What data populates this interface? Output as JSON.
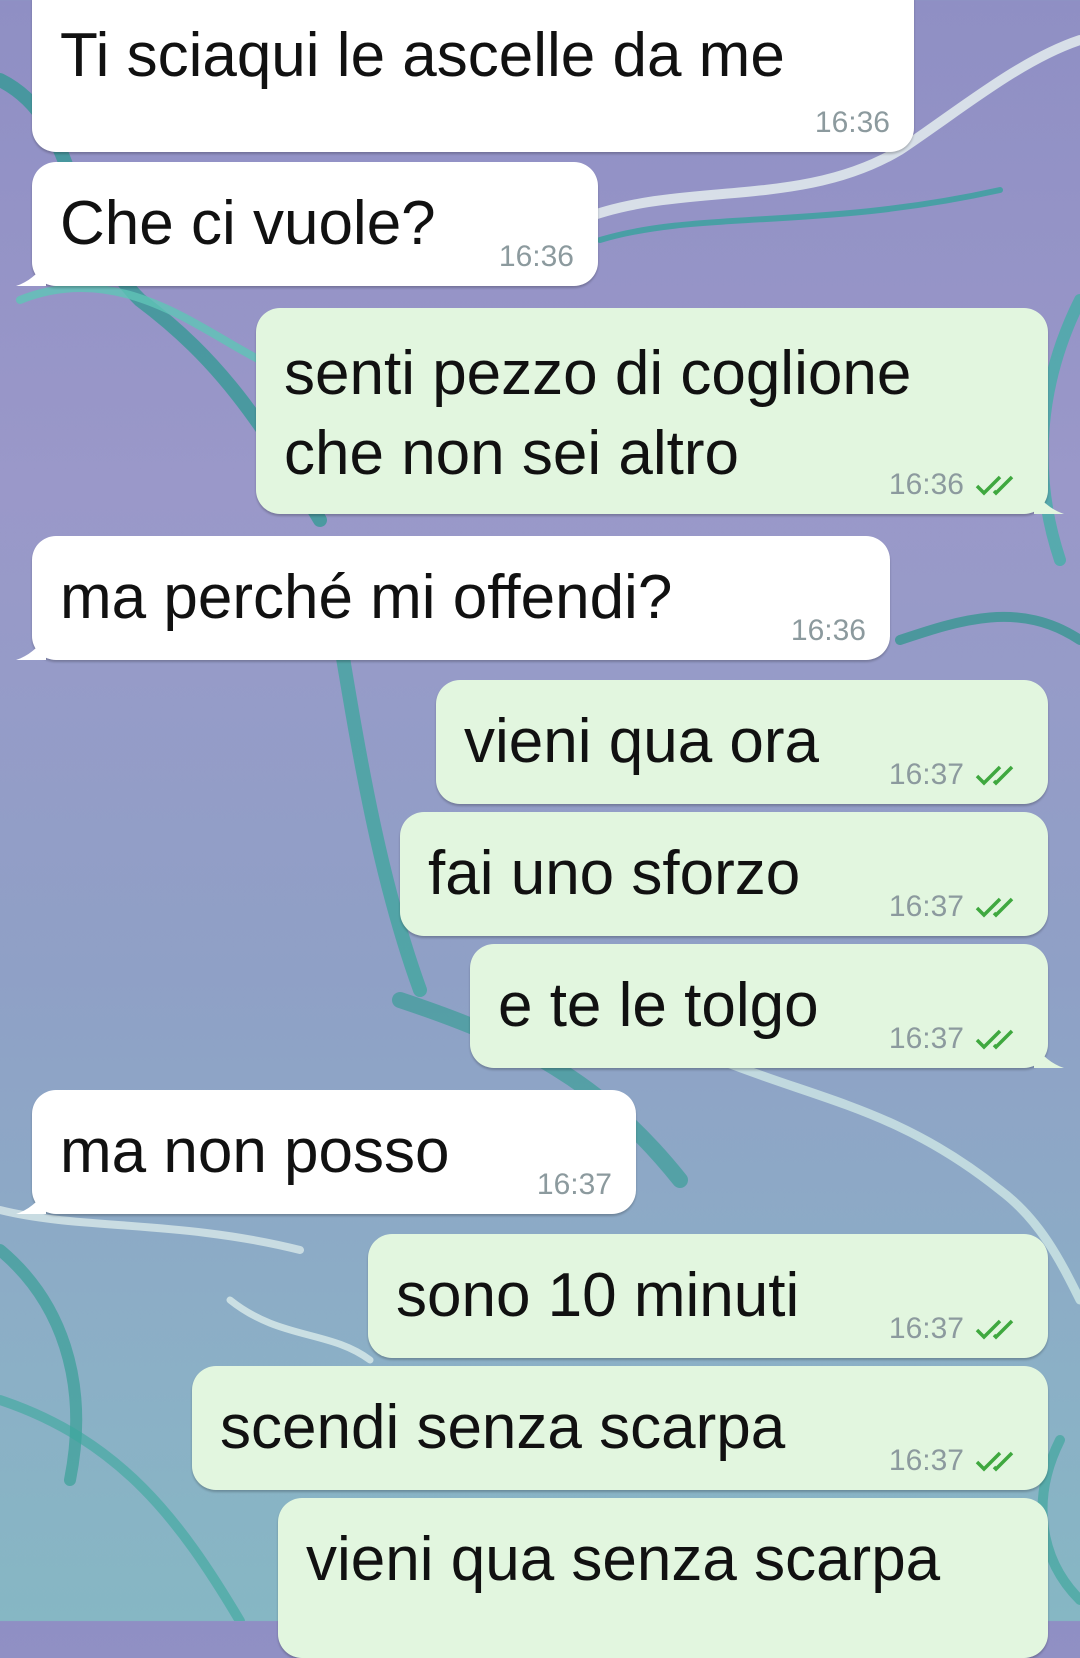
{
  "colors": {
    "incoming_bubble": "#ffffff",
    "outgoing_bubble": "#e2f6df",
    "read_ticks": "#3fa83f",
    "timestamp": "#8c9a9e"
  },
  "messages": [
    {
      "direction": "incoming",
      "lines": [
        "Ti sciaqui le ascelle da me"
      ],
      "time": "16:36"
    },
    {
      "direction": "incoming",
      "lines": [
        "Che ci vuole?"
      ],
      "time": "16:36"
    },
    {
      "direction": "outgoing",
      "lines": [
        "senti pezzo di coglione",
        "che non sei altro"
      ],
      "time": "16:36",
      "ticks": "read-ticks-icon"
    },
    {
      "direction": "incoming",
      "lines": [
        "ma perché mi offendi?"
      ],
      "time": "16:36"
    },
    {
      "direction": "outgoing",
      "lines": [
        "vieni qua ora"
      ],
      "time": "16:37",
      "ticks": "read-ticks-icon"
    },
    {
      "direction": "outgoing",
      "lines": [
        "fai uno sforzo"
      ],
      "time": "16:37",
      "ticks": "read-ticks-icon"
    },
    {
      "direction": "outgoing",
      "lines": [
        "e te le tolgo"
      ],
      "time": "16:37",
      "ticks": "read-ticks-icon"
    },
    {
      "direction": "incoming",
      "lines": [
        "ma non posso"
      ],
      "time": "16:37"
    },
    {
      "direction": "outgoing",
      "lines": [
        "sono 10 minuti"
      ],
      "time": "16:37",
      "ticks": "read-ticks-icon"
    },
    {
      "direction": "outgoing",
      "lines": [
        "scendi senza scarpa"
      ],
      "time": "16:37",
      "ticks": "read-ticks-icon"
    },
    {
      "direction": "outgoing",
      "lines": [
        "vieni qua senza scarpa"
      ]
    }
  ]
}
